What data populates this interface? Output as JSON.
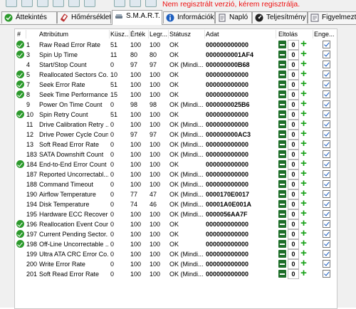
{
  "header_notice": "Nem regisztrált verzió, kérem regisztrálja.",
  "tabs": [
    {
      "label": "Áttekintés",
      "icon": "checkmark-icon",
      "active": false
    },
    {
      "label": "Hőmérséklet",
      "icon": "thermometer-icon",
      "active": false
    },
    {
      "label": "S.M.A.R.T.",
      "icon": "smart-icon",
      "active": true
    },
    {
      "label": "Információk",
      "icon": "info-icon",
      "active": false
    },
    {
      "label": "Napló",
      "icon": "log-icon",
      "active": false
    },
    {
      "label": "Teljesítmény",
      "icon": "performance-icon",
      "active": false
    },
    {
      "label": "Figyelmezt",
      "icon": "alert-icon",
      "active": false
    }
  ],
  "columns": {
    "num": "#",
    "attribute": "Attribútum",
    "threshold": "Küsz...",
    "value": "Érték",
    "worst": "Legr...",
    "status": "Státusz",
    "data": "Adat",
    "offset": "Eltolás",
    "enabled": "Enge..."
  },
  "rows": [
    {
      "ok": true,
      "num": "1",
      "attr": "Raw Read Error Rate",
      "thr": "51",
      "val": "100",
      "worst": "100",
      "status": "OK",
      "data": "000000000000",
      "offset": "0"
    },
    {
      "ok": true,
      "num": "3",
      "attr": "Spin Up Time",
      "thr": "11",
      "val": "80",
      "worst": "80",
      "status": "OK",
      "data": "0000000001AF4",
      "offset": "0"
    },
    {
      "ok": false,
      "num": "4",
      "attr": "Start/Stop Count",
      "thr": "0",
      "val": "97",
      "worst": "97",
      "status": "OK (Mindi...",
      "data": "000000000B68",
      "offset": "0"
    },
    {
      "ok": true,
      "num": "5",
      "attr": "Reallocated Sectors Co...",
      "thr": "10",
      "val": "100",
      "worst": "100",
      "status": "OK",
      "data": "000000000000",
      "offset": "0"
    },
    {
      "ok": true,
      "num": "7",
      "attr": "Seek Error Rate",
      "thr": "51",
      "val": "100",
      "worst": "100",
      "status": "OK",
      "data": "000000000000",
      "offset": "0"
    },
    {
      "ok": true,
      "num": "8",
      "attr": "Seek Time Performance",
      "thr": "15",
      "val": "100",
      "worst": "100",
      "status": "OK",
      "data": "000000000000",
      "offset": "0"
    },
    {
      "ok": false,
      "num": "9",
      "attr": "Power On Time Count",
      "thr": "0",
      "val": "98",
      "worst": "98",
      "status": "OK (Mindi...",
      "data": "0000000025B6",
      "offset": "0"
    },
    {
      "ok": true,
      "num": "10",
      "attr": "Spin Retry Count",
      "thr": "51",
      "val": "100",
      "worst": "100",
      "status": "OK",
      "data": "000000000000",
      "offset": "0"
    },
    {
      "ok": false,
      "num": "11",
      "attr": "Drive Calibration Retry ...",
      "thr": "0",
      "val": "100",
      "worst": "100",
      "status": "OK (Mindi...",
      "data": "000000000000",
      "offset": "0"
    },
    {
      "ok": false,
      "num": "12",
      "attr": "Drive Power Cycle Count",
      "thr": "0",
      "val": "97",
      "worst": "97",
      "status": "OK (Mindi...",
      "data": "000000000AC3",
      "offset": "0"
    },
    {
      "ok": false,
      "num": "13",
      "attr": "Soft Read Error Rate",
      "thr": "0",
      "val": "100",
      "worst": "100",
      "status": "OK (Mindi...",
      "data": "000000000000",
      "offset": "0"
    },
    {
      "ok": false,
      "num": "183",
      "attr": "SATA Downshift Count",
      "thr": "0",
      "val": "100",
      "worst": "100",
      "status": "OK (Mindi...",
      "data": "000000000000",
      "offset": "0"
    },
    {
      "ok": true,
      "num": "184",
      "attr": "End-to-End Error Count",
      "thr": "0",
      "val": "100",
      "worst": "100",
      "status": "OK",
      "data": "000000000000",
      "offset": "0"
    },
    {
      "ok": false,
      "num": "187",
      "attr": "Reported Uncorrectabl...",
      "thr": "0",
      "val": "100",
      "worst": "100",
      "status": "OK (Mindi...",
      "data": "000000000000",
      "offset": "0"
    },
    {
      "ok": false,
      "num": "188",
      "attr": "Command Timeout",
      "thr": "0",
      "val": "100",
      "worst": "100",
      "status": "OK (Mindi...",
      "data": "000000000000",
      "offset": "0"
    },
    {
      "ok": false,
      "num": "190",
      "attr": "Airflow Temperature",
      "thr": "0",
      "val": "77",
      "worst": "47",
      "status": "OK (Mindi...",
      "data": "0000170E0017",
      "offset": "0"
    },
    {
      "ok": false,
      "num": "194",
      "attr": "Disk Temperature",
      "thr": "0",
      "val": "74",
      "worst": "46",
      "status": "OK (Mindi...",
      "data": "00001A0E001A",
      "offset": "0"
    },
    {
      "ok": false,
      "num": "195",
      "attr": "Hardware ECC Recovered",
      "thr": "0",
      "val": "100",
      "worst": "100",
      "status": "OK (Mindi...",
      "data": "0000056AA7F",
      "offset": "0"
    },
    {
      "ok": true,
      "num": "196",
      "attr": "Reallocation Event Count",
      "thr": "0",
      "val": "100",
      "worst": "100",
      "status": "OK",
      "data": "000000000000",
      "offset": "0"
    },
    {
      "ok": true,
      "num": "197",
      "attr": "Current Pending Sector...",
      "thr": "0",
      "val": "100",
      "worst": "100",
      "status": "OK",
      "data": "000000000000",
      "offset": "0"
    },
    {
      "ok": true,
      "num": "198",
      "attr": "Off-Line Uncorrectable ...",
      "thr": "0",
      "val": "100",
      "worst": "100",
      "status": "OK",
      "data": "000000000000",
      "offset": "0"
    },
    {
      "ok": false,
      "num": "199",
      "attr": "Ultra ATA CRC Error Co...",
      "thr": "0",
      "val": "100",
      "worst": "100",
      "status": "OK (Mindi...",
      "data": "000000000000",
      "offset": "0"
    },
    {
      "ok": false,
      "num": "200",
      "attr": "Write Error Rate",
      "thr": "0",
      "val": "100",
      "worst": "100",
      "status": "OK (Mindi...",
      "data": "000000000000",
      "offset": "0"
    },
    {
      "ok": false,
      "num": "201",
      "attr": "Soft Read Error Rate",
      "thr": "0",
      "val": "100",
      "worst": "100",
      "status": "OK (Mindi...",
      "data": "000000000000",
      "offset": "0"
    }
  ]
}
